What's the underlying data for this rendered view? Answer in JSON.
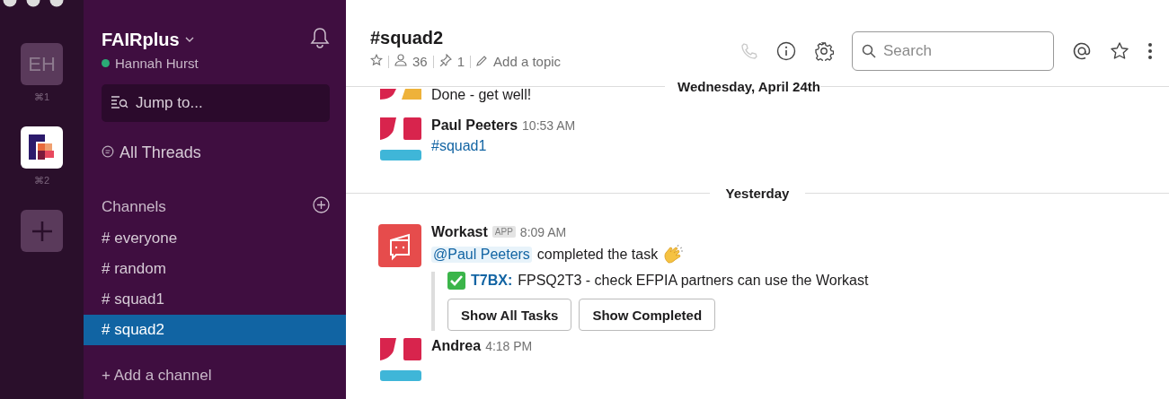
{
  "workspaces": [
    {
      "kind": "initials",
      "initials": "EH",
      "shortcut": "⌘1",
      "selected": false
    },
    {
      "kind": "logo",
      "shortcut": "⌘2",
      "selected": true
    }
  ],
  "sidebar": {
    "team": "FAIRplus",
    "user": "Hannah Hurst",
    "user_online": true,
    "jump_placeholder": "Jump to...",
    "all_threads": "All Threads",
    "channels_heading": "Channels",
    "channels": [
      {
        "name": "# everyone",
        "selected": false
      },
      {
        "name": "# random",
        "selected": false
      },
      {
        "name": "# squad1",
        "selected": false
      },
      {
        "name": "# squad2",
        "selected": true
      }
    ],
    "add_channel": "+ Add a channel"
  },
  "header": {
    "channel": "#squad2",
    "members": "36",
    "pins": "1",
    "topic": "Add a topic",
    "search_placeholder": "Search"
  },
  "sticky_divider": "Wednesday, April 24th",
  "messages": [
    {
      "kind": "continuation",
      "avatar": {
        "kind": "partial"
      },
      "text": "Done - get well!"
    },
    {
      "kind": "message",
      "avatar": {
        "kind": "blocks"
      },
      "author": "Paul Peeters",
      "time": "10:53 AM",
      "channel_link": "#squad1"
    },
    {
      "kind": "divider",
      "label": "Yesterday"
    },
    {
      "kind": "message",
      "avatar": {
        "kind": "app"
      },
      "author": "Workast",
      "badge": "APP",
      "time": "8:09 AM",
      "mention": "@Paul Peeters",
      "text": "completed the task",
      "attachment": {
        "task_id": "T7BX:",
        "text": "FPSQ2T3 - check EFPIA partners can use the Workast",
        "buttons": [
          "Show All Tasks",
          "Show Completed"
        ]
      }
    },
    {
      "kind": "message",
      "avatar": {
        "kind": "blocks"
      },
      "author": "Andrea",
      "time": "4:18 PM"
    }
  ]
}
